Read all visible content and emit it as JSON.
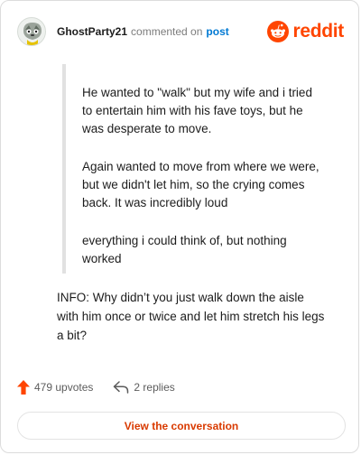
{
  "header": {
    "username": "GhostParty21",
    "action": "commented on",
    "link": "post",
    "brand": "reddit"
  },
  "quoted": [
    "He wanted to \"walk\" but my wife and i tried to entertain him with his fave toys, but he was desperate to move.",
    "Again wanted to move from where we were, but we didn't let him, so the crying comes back. It was incredibly loud",
    "everything i could think of, but nothing worked"
  ],
  "reply": "INFO: Why didn’t you just walk down the aisle with him once or twice and let him stretch his legs a bit?",
  "stats": {
    "upvotes": "479 upvotes",
    "replies": "2 replies"
  },
  "cta": "View the conversation",
  "colors": {
    "brand": "#ff4500",
    "link": "#0079d3",
    "upvote": "#ff4500",
    "cta_text": "#d93a00",
    "quote_bar": "#e1e1e1"
  },
  "icons": {
    "avatar": "avatar-icon",
    "brand": "reddit-logo-icon",
    "upvote": "upvote-arrow-icon",
    "reply": "reply-arrow-icon"
  }
}
